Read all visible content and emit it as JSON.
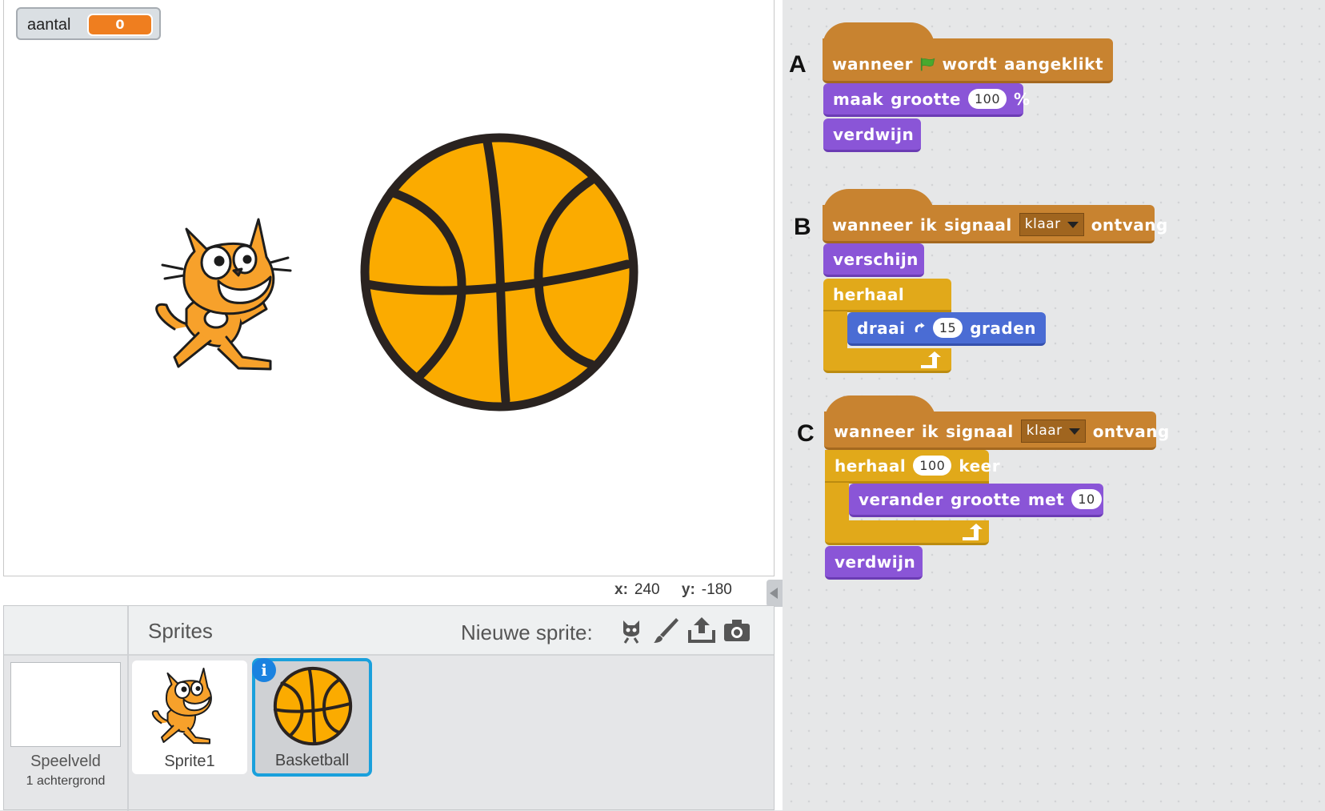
{
  "stage": {
    "variable": {
      "name": "aantal",
      "value": "0"
    },
    "coordinates": {
      "x_label": "x:",
      "x": "240",
      "y_label": "y:",
      "y": "-180"
    }
  },
  "sprite_pane": {
    "stage_label": "Speelveld",
    "stage_sublabel": "1 achtergrond",
    "sprites_title": "Sprites",
    "new_sprite_label": "Nieuwe sprite:",
    "tools": [
      "sprite-library-icon",
      "paint-brush-icon",
      "upload-icon",
      "camera-icon"
    ],
    "sprites": [
      {
        "name": "Sprite1",
        "selected": false
      },
      {
        "name": "Basketball",
        "selected": true
      }
    ]
  },
  "scripts": {
    "A": {
      "letter": "A",
      "hat": {
        "w1": "wanneer",
        "w2": "wordt",
        "w3": "aangeklikt"
      },
      "b1": {
        "w1": "maak",
        "w2": "grootte",
        "value": "100",
        "unit": "%"
      },
      "b2": "verdwijn"
    },
    "B": {
      "letter": "B",
      "hat": {
        "w1": "wanneer",
        "w2": "ik",
        "w3": "signaal",
        "dropdown": "klaar",
        "w4": "ontvang"
      },
      "b1": "verschijn",
      "loop": "herhaal",
      "inner": {
        "w1": "draai",
        "value": "15",
        "w2": "graden"
      }
    },
    "C": {
      "letter": "C",
      "hat": {
        "w1": "wanneer",
        "w2": "ik",
        "w3": "signaal",
        "dropdown": "klaar",
        "w4": "ontvang"
      },
      "loop": {
        "w1": "herhaal",
        "value": "100",
        "w2": "keer"
      },
      "inner": {
        "w1": "verander",
        "w2": "grootte",
        "w3": "met",
        "value": "10"
      },
      "b_after": "verdwijn"
    }
  },
  "colors": {
    "events": "#c88330",
    "looks": "#8a55d7",
    "control": "#e1a91a",
    "motion": "#4a6cd4",
    "variable": "#ef7e1f",
    "selection": "#1aa0dc"
  }
}
